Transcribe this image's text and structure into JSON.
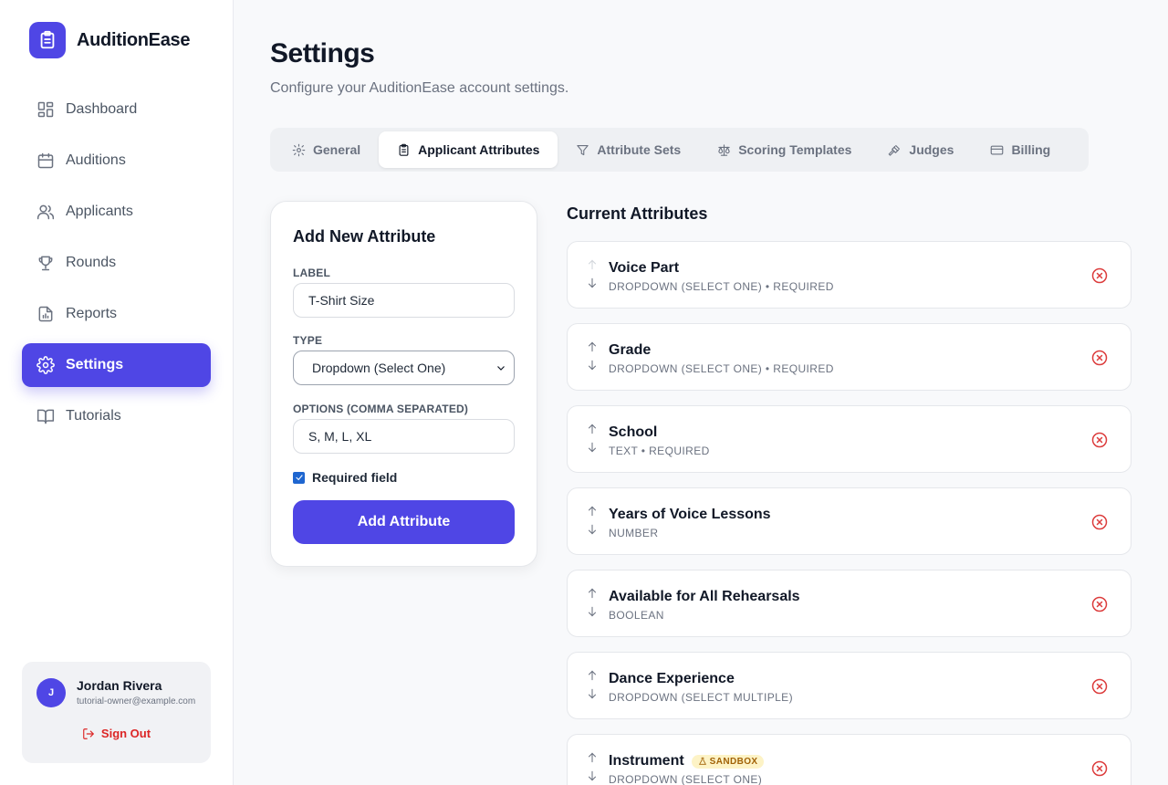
{
  "app": {
    "name": "AuditionEase"
  },
  "sidebar": {
    "items": [
      {
        "label": "Dashboard",
        "icon": "dashboard-icon",
        "active": false
      },
      {
        "label": "Auditions",
        "icon": "calendar-icon",
        "active": false
      },
      {
        "label": "Applicants",
        "icon": "users-icon",
        "active": false
      },
      {
        "label": "Rounds",
        "icon": "trophy-icon",
        "active": false
      },
      {
        "label": "Reports",
        "icon": "report-icon",
        "active": false
      },
      {
        "label": "Settings",
        "icon": "gear-icon",
        "active": true
      },
      {
        "label": "Tutorials",
        "icon": "book-icon",
        "active": false
      }
    ]
  },
  "user": {
    "initial": "J",
    "name": "Jordan Rivera",
    "email": "tutorial-owner@example.com",
    "sign_out": "Sign Out"
  },
  "header": {
    "title": "Settings",
    "subtitle": "Configure your AuditionEase account settings."
  },
  "tabs": [
    {
      "label": "General",
      "icon": "gear-icon",
      "active": false
    },
    {
      "label": "Applicant Attributes",
      "icon": "clipboard-icon",
      "active": true
    },
    {
      "label": "Attribute Sets",
      "icon": "filter-icon",
      "active": false
    },
    {
      "label": "Scoring Templates",
      "icon": "scale-icon",
      "active": false
    },
    {
      "label": "Judges",
      "icon": "gavel-icon",
      "active": false
    },
    {
      "label": "Billing",
      "icon": "credit-card-icon",
      "active": false
    }
  ],
  "form": {
    "title": "Add New Attribute",
    "label_label": "LABEL",
    "label_value": "T-Shirt Size",
    "type_label": "TYPE",
    "type_value": "Dropdown (Select One)",
    "options_label": "OPTIONS (COMMA SEPARATED)",
    "options_value": "S, M, L, XL",
    "required_label": "Required field",
    "required_checked": true,
    "submit_label": "Add Attribute"
  },
  "attributes": {
    "title": "Current Attributes",
    "items": [
      {
        "name": "Voice Part",
        "meta": "DROPDOWN (SELECT ONE) • REQUIRED",
        "up_disabled": true,
        "badge": ""
      },
      {
        "name": "Grade",
        "meta": "DROPDOWN (SELECT ONE) • REQUIRED",
        "up_disabled": false,
        "badge": ""
      },
      {
        "name": "School",
        "meta": "TEXT • REQUIRED",
        "up_disabled": false,
        "badge": ""
      },
      {
        "name": "Years of Voice Lessons",
        "meta": "NUMBER",
        "up_disabled": false,
        "badge": ""
      },
      {
        "name": "Available for All Rehearsals",
        "meta": "BOOLEAN",
        "up_disabled": false,
        "badge": ""
      },
      {
        "name": "Dance Experience",
        "meta": "DROPDOWN (SELECT MULTIPLE)",
        "up_disabled": false,
        "badge": ""
      },
      {
        "name": "Instrument",
        "meta": "DROPDOWN (SELECT ONE)",
        "up_disabled": false,
        "badge": "SANDBOX"
      }
    ]
  },
  "colors": {
    "accent": "#4f46e5",
    "danger": "#dc3c3c",
    "badge_bg": "#fdf3c6"
  }
}
